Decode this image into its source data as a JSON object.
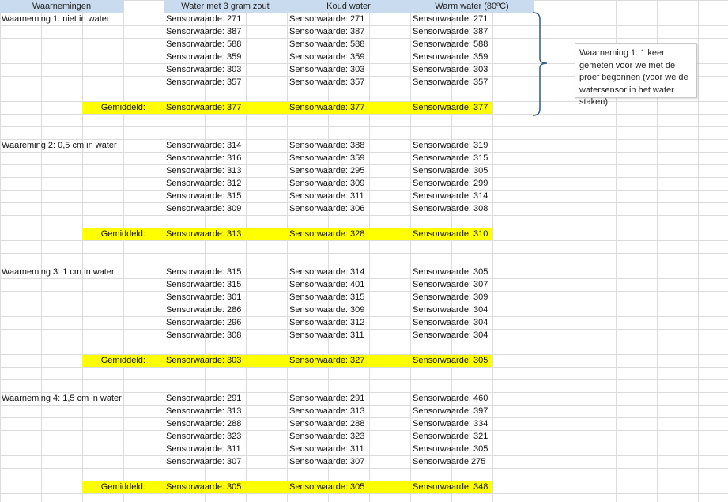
{
  "headers": [
    "Waarnemingen",
    "Water met 3 gram zout",
    "Koud water",
    "Warm water (80ºC)"
  ],
  "avg_label": "Gemiddeld:",
  "note": "Waarneming 1: 1 keer gemeten voor we met de proef begonnen (voor we de watersensor in het water staken)",
  "blocks": [
    {
      "title": "Waarneming 1: niet in water",
      "rows": [
        [
          "Sensorwaarde: 271",
          "Sensorwaarde: 271",
          "Sensorwaarde: 271"
        ],
        [
          "Sensorwaarde: 387",
          "Sensorwaarde: 387",
          "Sensorwaarde: 387"
        ],
        [
          "Sensorwaarde: 588",
          "Sensorwaarde: 588",
          "Sensorwaarde: 588"
        ],
        [
          "Sensorwaarde: 359",
          "Sensorwaarde: 359",
          "Sensorwaarde: 359"
        ],
        [
          "Sensorwaarde: 303",
          "Sensorwaarde: 303",
          "Sensorwaarde: 303"
        ],
        [
          "Sensorwaarde: 357",
          "Sensorwaarde: 357",
          "Sensorwaarde: 357"
        ]
      ],
      "avg": [
        "Sensorwaarde: 377",
        "Sensorwaarde: 377",
        "Sensorwaarde: 377"
      ]
    },
    {
      "title": "Waareming 2: 0,5 cm in water",
      "rows": [
        [
          "Sensorwaarde: 314",
          "Sensorwaarde: 388",
          "Sensorwaarde: 319"
        ],
        [
          "Sensorwaarde: 316",
          "Sensorwaarde: 359",
          "Sensorwaarde: 315"
        ],
        [
          "Sensorwaarde: 313",
          "Sensorwaarde: 295",
          "Sensorwaarde: 305"
        ],
        [
          "Sensorwaarde: 312",
          "Sensorwaarde: 309",
          "Sensorwaarde: 299"
        ],
        [
          "Sensorwaarde: 315",
          "Sensorwaarde: 311",
          "Sensorwaarde: 314"
        ],
        [
          "Sensorwaarde: 309",
          "Sensorwaarde: 306",
          "Sensorwaarde: 308"
        ]
      ],
      "avg": [
        "Sensorwaarde: 313",
        "Sensorwaarde: 328",
        "Sensorwaarde: 310"
      ]
    },
    {
      "title": "Waarneming 3: 1 cm in water",
      "rows": [
        [
          "Sensorwaarde: 315",
          "Sensorwaarde: 314",
          "Sensorwaarde: 305"
        ],
        [
          "Sensorwaarde: 315",
          "Sensorwaarde: 401",
          "Sensorwaarde: 307"
        ],
        [
          "Sensorwaarde: 301",
          "Sensorwaarde: 315",
          "Sensorwaarde: 309"
        ],
        [
          "Sensorwaarde: 286",
          "Sensorwaarde: 309",
          "Sensorwaarde: 304"
        ],
        [
          "Sensorwaarde: 296",
          "Sensorwaarde: 312",
          "Sensorwaarde: 304"
        ],
        [
          "Sensorwaarde: 308",
          "Sensorwaarde: 311",
          "Sensorwaarde: 304"
        ]
      ],
      "avg": [
        "Sensorwaarde: 303",
        "Sensorwaarde: 327",
        "Sensorwaarde: 305"
      ]
    },
    {
      "title": "Waarneming 4: 1,5 cm in water",
      "rows": [
        [
          "Sensorwaarde: 291",
          "Sensorwaarde: 291",
          "Sensorwaarde: 460"
        ],
        [
          "Sensorwaarde: 313",
          "Sensorwaarde: 313",
          "Sensorwaarde: 397"
        ],
        [
          "Sensorwaarde: 288",
          "Sensorwaarde: 288",
          "Sensorwaarde: 334"
        ],
        [
          "Sensorwaarde: 323",
          "Sensorwaarde: 323",
          "Sensorwaarde: 321"
        ],
        [
          "Sensorwaarde: 311",
          "Sensorwaarde: 311",
          "Sensorwaarde: 305"
        ],
        [
          "Sensorwaarde: 307",
          "Sensorwaarde: 307",
          "Sensorwaarde 275"
        ]
      ],
      "avg": [
        "Sensorwaarde: 305",
        "Sensorwaarde: 305",
        "Sensorwaarde: 348"
      ]
    }
  ]
}
